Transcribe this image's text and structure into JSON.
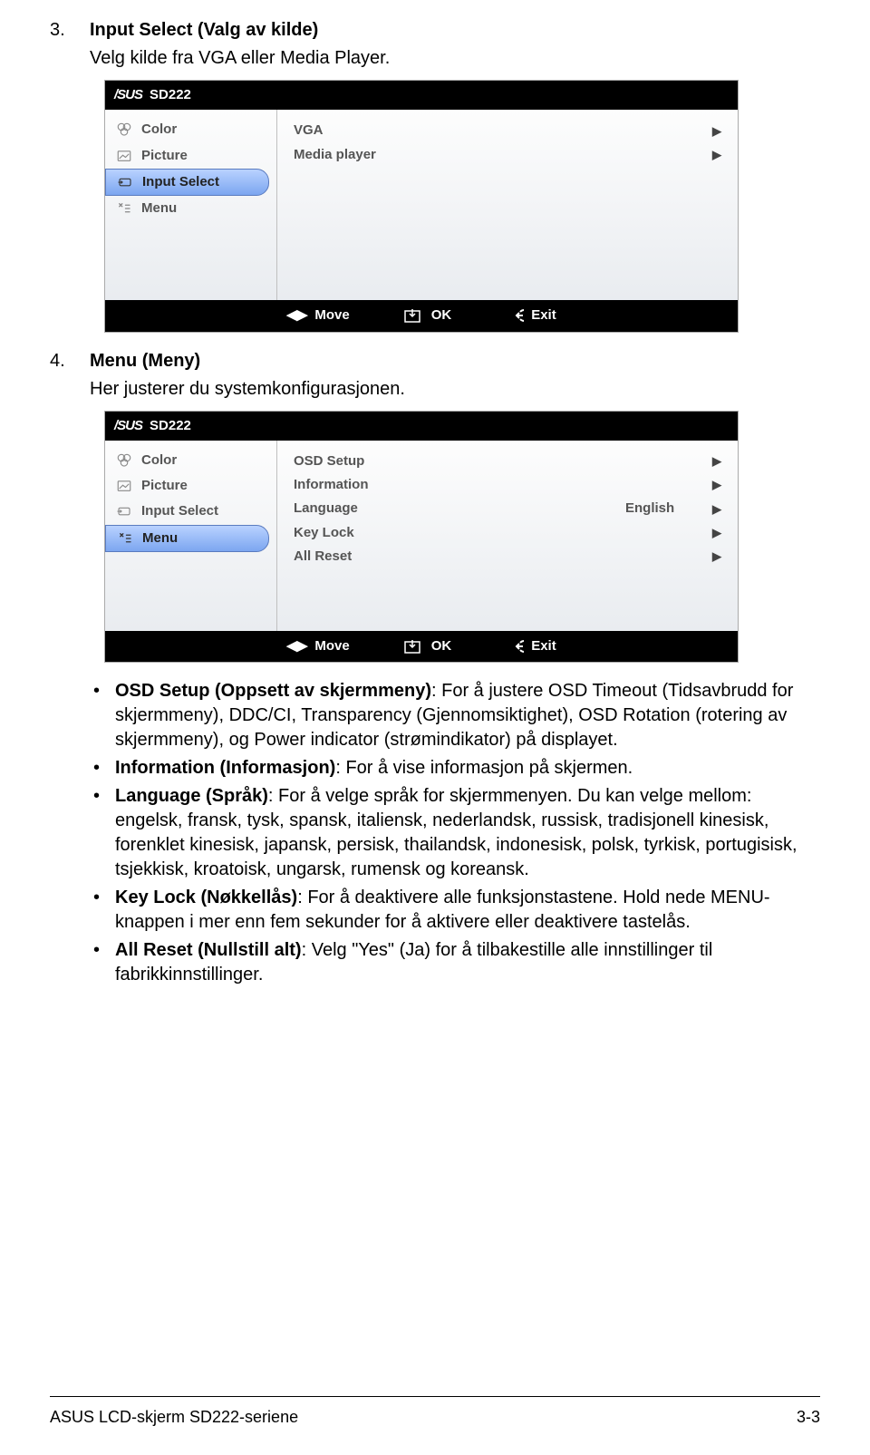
{
  "section3": {
    "num": "3.",
    "title": "Input Select (Valg av kilde)",
    "desc": "Velg kilde fra VGA eller Media Player."
  },
  "osd1": {
    "model": "SD222",
    "side": {
      "color": "Color",
      "picture": "Picture",
      "input_select": "Input Select",
      "menu": "Menu"
    },
    "rows": [
      {
        "label": "VGA",
        "value": "",
        "arrow": "▶"
      },
      {
        "label": "Media player",
        "value": "",
        "arrow": "▶"
      }
    ],
    "footer": {
      "move": "Move",
      "ok": "OK",
      "exit": "Exit"
    }
  },
  "section4": {
    "num": "4.",
    "title": "Menu (Meny)",
    "desc": "Her justerer du systemkonfigurasjonen."
  },
  "osd2": {
    "model": "SD222",
    "side": {
      "color": "Color",
      "picture": "Picture",
      "input_select": "Input Select",
      "menu": "Menu"
    },
    "rows": [
      {
        "label": "OSD Setup",
        "value": "",
        "arrow": "▶"
      },
      {
        "label": "Information",
        "value": "",
        "arrow": "▶"
      },
      {
        "label": "Language",
        "value": "English",
        "arrow": "▶"
      },
      {
        "label": "Key Lock",
        "value": "",
        "arrow": "▶"
      },
      {
        "label": "All Reset",
        "value": "",
        "arrow": "▶"
      }
    ],
    "footer": {
      "move": "Move",
      "ok": "OK",
      "exit": "Exit"
    }
  },
  "bullets": {
    "b1_bold": "OSD Setup (Oppsett av skjermmeny)",
    "b1_rest": ": For å justere OSD Timeout (Tidsavbrudd for skjermmeny), DDC/CI, Transparency (Gjennomsiktighet), OSD Rotation (rotering av skjermmeny), og Power indicator (strømindikator) på displayet.",
    "b2_bold": "Information (Informasjon)",
    "b2_rest": ": For å vise informasjon på skjermen.",
    "b3_bold": "Language (Språk)",
    "b3_rest": ": For å velge språk for skjermmenyen. Du kan velge mellom: engelsk, fransk, tysk, spansk, italiensk, nederlandsk, russisk, tradisjonell kinesisk, forenklet kinesisk, japansk, persisk, thailandsk, indonesisk, polsk, tyrkisk, portugisisk, tsjekkisk, kroatoisk, ungarsk, rumensk og koreansk.",
    "b4_bold": "Key Lock (Nøkkellås)",
    "b4_rest": ": For å deaktivere alle funksjonstastene. Hold nede MENU-knappen i mer enn fem sekunder for å aktivere eller deaktivere tastelås.",
    "b5_bold": "All Reset (Nullstill alt)",
    "b5_rest": ": Velg \"Yes\" (Ja) for å tilbakestille alle innstillinger til fabrikkinnstillinger."
  },
  "footer": {
    "left": "ASUS LCD-skjerm SD222-seriene",
    "right": "3-3"
  }
}
